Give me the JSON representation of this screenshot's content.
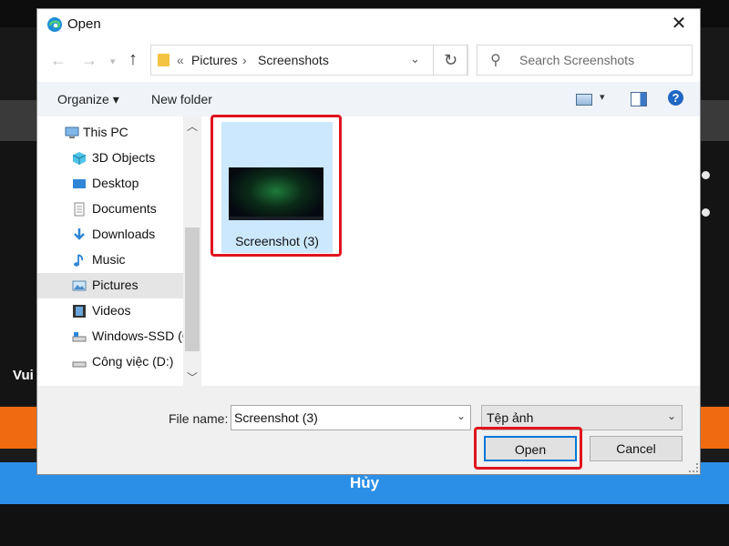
{
  "background_app": {
    "side_text": "Vui",
    "cancel_bar_label": "Hủy"
  },
  "dialog": {
    "title": "Open",
    "nav": {
      "back_icon": "arrow-left-icon",
      "forward_icon": "arrow-right-icon",
      "recent_icon": "chevron-down-icon",
      "up_icon": "arrow-up-icon",
      "up_glyph": "↑",
      "breadcrumb_prefix": "«",
      "breadcrumb": [
        "Pictures",
        "Screenshots"
      ],
      "separator": "›",
      "search_placeholder": "Search Screenshots"
    },
    "toolbar": {
      "organize_label": "Organize ▾",
      "new_folder_label": "New folder",
      "help_label": "?"
    },
    "sidebar": {
      "items": [
        {
          "label": "This PC",
          "icon": "computer-icon"
        },
        {
          "label": "3D Objects",
          "icon": "cube-icon"
        },
        {
          "label": "Desktop",
          "icon": "desktop-icon"
        },
        {
          "label": "Documents",
          "icon": "document-icon"
        },
        {
          "label": "Downloads",
          "icon": "download-icon"
        },
        {
          "label": "Music",
          "icon": "music-icon"
        },
        {
          "label": "Pictures",
          "icon": "picture-icon",
          "selected": true
        },
        {
          "label": "Videos",
          "icon": "video-icon"
        },
        {
          "label": "Windows-SSD (C",
          "icon": "drive-icon"
        },
        {
          "label": "Công việc (D:)",
          "icon": "drive-icon"
        }
      ]
    },
    "files": [
      {
        "name": "Screenshot (3)",
        "selected": true
      }
    ],
    "footer": {
      "file_name_label": "File name:",
      "file_name_value": "Screenshot (3)",
      "file_type_value": "Tệp ảnh",
      "open_label": "Open",
      "cancel_label": "Cancel"
    },
    "colors": {
      "accent": "#0078d7",
      "selection": "#cce8ff",
      "highlight_box": "#e0141e"
    }
  }
}
